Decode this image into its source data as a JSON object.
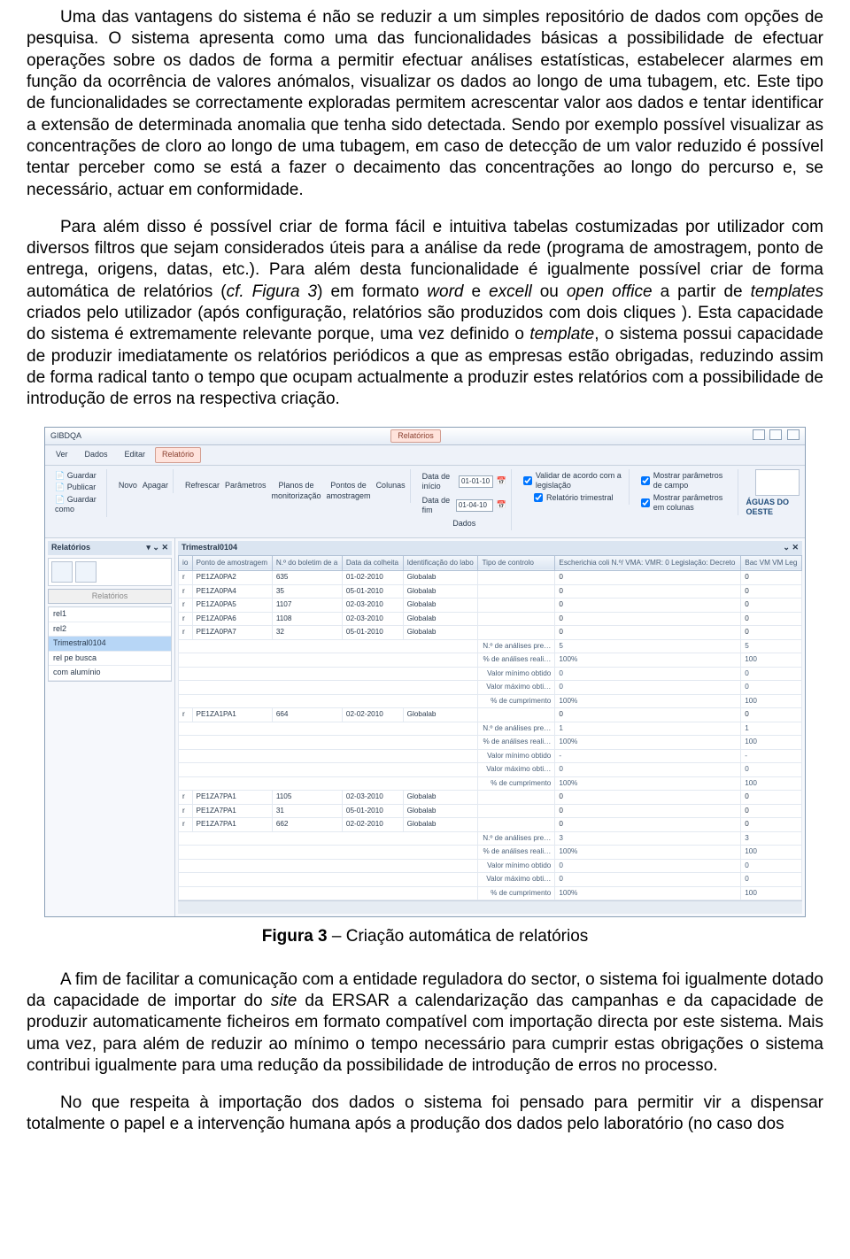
{
  "paragraphs": {
    "p1": "Uma das vantagens do sistema é não se reduzir a um simples repositório de dados com opções de pesquisa. O sistema apresenta como uma das funcionalidades básicas a possibilidade de efectuar operações sobre os dados de forma a permitir efectuar análises estatísticas, estabelecer alarmes em função da ocorrência de valores anómalos, visualizar os dados ao longo de uma tubagem, etc. Este tipo de funcionalidades se correctamente exploradas permitem acrescentar valor aos dados e tentar identificar a extensão de determinada anomalia que tenha sido detectada. Sendo por exemplo possível visualizar as concentrações de cloro ao longo de uma tubagem, em caso de detecção de um valor reduzido é possível tentar perceber como se está a fazer o decaimento das concentrações ao longo do percurso e, se necessário, actuar em conformidade.",
    "p2a": "Para além disso é possível criar de forma fácil e intuitiva tabelas costumizadas por utilizador com diversos filtros que sejam considerados úteis para a análise da rede (programa de amostragem, ponto de entrega, origens, datas, etc.). Para além desta funcionalidade é igualmente possível criar de forma automática de relatórios (",
    "p2b": ") em formato ",
    "p2c": " e ",
    "p2d": " ou ",
    "p2e": " a partir de ",
    "p2f": " criados pelo utilizador (após configuração, relatórios são produzidos com dois cliques ). Esta capacidade do sistema é extremamente relevante porque, uma vez definido o ",
    "p2g": ", o sistema possui capacidade de produzir imediatamente os relatórios periódicos a que as empresas estão obrigadas, reduzindo assim de forma radical tanto o tempo que ocupam actualmente a produzir estes relatórios com a possibilidade de introdução de erros na respectiva criação.",
    "cf": "cf. Figura 3",
    "word": "word",
    "excell": "excell",
    "openoffice": "open office",
    "templates": "templates",
    "template": "template",
    "caption": "Figura 3 – Criação automática de relatórios",
    "caption_b": "Figura 3",
    "caption_t": " – Criação automática de relatórios",
    "p3a": "A fim de facilitar a comunicação com a entidade reguladora do sector, o sistema foi igualmente dotado da capacidade de importar do ",
    "site": "site",
    "p3b": " da ERSAR a calendarização das campanhas e da capacidade de produzir automaticamente ficheiros em formato compatível com importação directa por este sistema. Mais uma vez, para além de reduzir ao mínimo o tempo necessário para cumprir estas obrigações o sistema contribui igualmente para uma redução da possibilidade de introdução de erros no processo.",
    "p4": "No que respeita à importação dos dados o sistema foi pensado para permitir vir a dispensar totalmente o papel e a intervenção humana após a produção dos dados pelo laboratório (no caso dos"
  },
  "app": {
    "brand": "GIBDQA",
    "logo": "ÁGUAS DO OESTE",
    "menus": [
      "Ver",
      "Dados",
      "Editar",
      "Relatório"
    ],
    "active_tab": "Relatórios",
    "actions": {
      "guardar": "Guardar",
      "publicar": "Publicar",
      "guardar_como": "Guardar como",
      "novo": "Novo",
      "apagar": "Apagar",
      "refrescar": "Refrescar",
      "parametros": "Parâmetros",
      "planos": "Planos de monitorização",
      "pontos": "Pontos de amostragem",
      "colunas": "Colunas",
      "dados": "Dados"
    },
    "dates": {
      "inicio_lbl": "Data de início",
      "inicio": "01-01-10",
      "fim_lbl": "Data de fim",
      "fim": "01-04-10"
    },
    "checks": {
      "validar": "Validar de acordo com a legislação",
      "rel_trim": "Relatório trimestral",
      "mostrar_campo": "Mostrar parâmetros de campo",
      "mostrar_col": "Mostrar parâmetros em colunas"
    },
    "sidebar": {
      "title": "Relatórios",
      "tool1": "=",
      "tool2": "=",
      "input": "Relatórios",
      "items": [
        "rel1",
        "rel2",
        "Trimestral0104",
        "rel pe busca",
        "com alumínio"
      ]
    },
    "grid": {
      "title": "Trimestral0104",
      "cols": [
        "io",
        "Ponto de amostragem",
        "N.º do boletim de a",
        "Data da colheita",
        "Identificação do labo",
        "Tipo de controlo",
        "Escherichia coli N.º/\nVMA:\nVMR: 0\nLegislação: Decreto",
        "Bac\nVM\nVM\nLeg"
      ],
      "rows": [
        [
          "r",
          "PE1ZA0PA2",
          "635",
          "01-02-2010",
          "Globalab",
          "",
          "0",
          "0"
        ],
        [
          "r",
          "PE1ZA0PA4",
          "35",
          "05-01-2010",
          "Globalab",
          "",
          "0",
          "0"
        ],
        [
          "r",
          "PE1ZA0PA5",
          "1107",
          "02-03-2010",
          "Globalab",
          "",
          "0",
          "0"
        ],
        [
          "r",
          "PE1ZA0PA6",
          "1108",
          "02-03-2010",
          "Globalab",
          "",
          "0",
          "0"
        ],
        [
          "r",
          "PE1ZA0PA7",
          "32",
          "05-01-2010",
          "Globalab",
          "",
          "0",
          "0"
        ]
      ],
      "summary1": [
        [
          "N.º de análises pre…",
          "5",
          "5"
        ],
        [
          "% de análises reali…",
          "100%",
          "100"
        ],
        [
          "Valor mínimo obtido",
          "0",
          "0"
        ],
        [
          "Valor máximo obti…",
          "0",
          "0"
        ],
        [
          "% de cumprimento",
          "100%",
          "100"
        ]
      ],
      "rows2": [
        [
          "r",
          "PE1ZA1PA1",
          "664",
          "02-02-2010",
          "Globalab",
          "",
          "0",
          "0"
        ]
      ],
      "summary2": [
        [
          "N.º de análises pre…",
          "1",
          "1"
        ],
        [
          "% de análises reali…",
          "100%",
          "100"
        ],
        [
          "Valor mínimo obtido",
          "-",
          "-"
        ],
        [
          "Valor máximo obti…",
          "0",
          "0"
        ],
        [
          "% de cumprimento",
          "100%",
          "100"
        ]
      ],
      "rows3": [
        [
          "r",
          "PE1ZA7PA1",
          "1105",
          "02-03-2010",
          "Globalab",
          "",
          "0",
          "0"
        ],
        [
          "r",
          "PE1ZA7PA1",
          "31",
          "05-01-2010",
          "Globalab",
          "",
          "0",
          "0"
        ],
        [
          "r",
          "PE1ZA7PA1",
          "662",
          "02-02-2010",
          "Globalab",
          "",
          "0",
          "0"
        ]
      ],
      "summary3": [
        [
          "N.º de análises pre…",
          "3",
          "3"
        ],
        [
          "% de análises reali…",
          "100%",
          "100"
        ],
        [
          "Valor mínimo obtido",
          "0",
          "0"
        ],
        [
          "Valor máximo obti…",
          "0",
          "0"
        ],
        [
          "% de cumprimento",
          "100%",
          "100"
        ]
      ]
    }
  }
}
